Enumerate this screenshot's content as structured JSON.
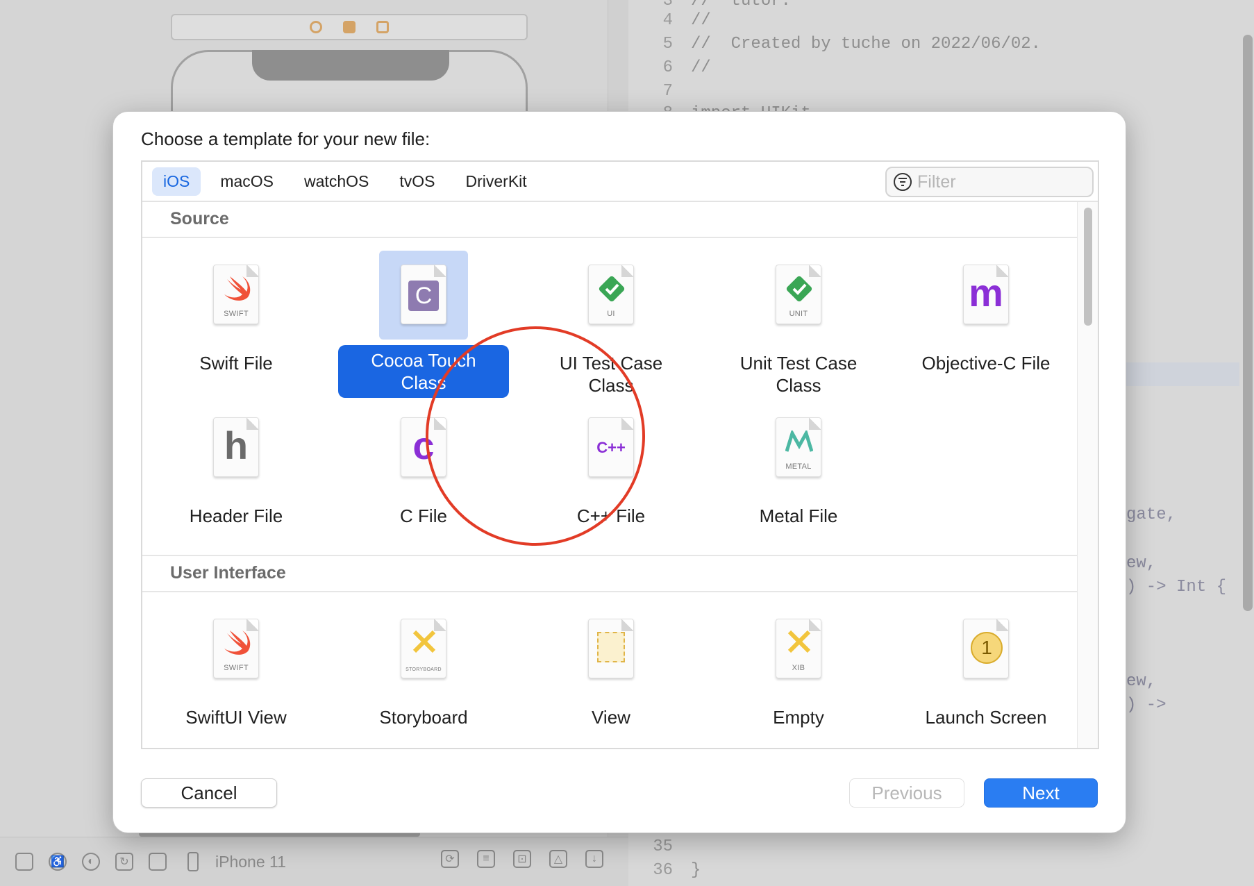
{
  "background": {
    "device_name": "iPhone 11",
    "code_lines": [
      {
        "num": "3",
        "text": "//  tutor."
      },
      {
        "num": "4",
        "text": "//"
      },
      {
        "num": "5",
        "text": "//  Created by tuche on 2022/06/02."
      },
      {
        "num": "6",
        "text": "//"
      },
      {
        "num": "7",
        "text": ""
      },
      {
        "num": "8",
        "text": "import UIKit"
      }
    ],
    "code_fragments": [
      "gate,",
      "ew,",
      ") -> Int {",
      "ew,",
      ") ->"
    ],
    "bottom_lines": [
      {
        "num": "35",
        "text": ""
      },
      {
        "num": "36",
        "text": "}"
      }
    ]
  },
  "dialog": {
    "title": "Choose a template for your new file:",
    "platform_tabs": [
      "iOS",
      "macOS",
      "watchOS",
      "tvOS",
      "DriverKit"
    ],
    "active_tab": "iOS",
    "filter_placeholder": "Filter",
    "sections": [
      {
        "name": "Source",
        "items": [
          {
            "label": "Swift File",
            "icon": "swift-icon",
            "badge": "SWIFT"
          },
          {
            "label": "Cocoa Touch Class",
            "icon": "cocoa-touch-class-icon",
            "badge": "C",
            "selected": true
          },
          {
            "label": "UI Test Case Class",
            "icon": "ui-test-icon",
            "badge": "UI"
          },
          {
            "label": "Unit Test Case Class",
            "icon": "unit-test-icon",
            "badge": "UNIT"
          },
          {
            "label": "Objective-C File",
            "icon": "objective-c-icon",
            "badge": "m"
          },
          {
            "label": "Header File",
            "icon": "header-file-icon",
            "badge": "h"
          },
          {
            "label": "C File",
            "icon": "c-file-icon",
            "badge": "c"
          },
          {
            "label": "C++ File",
            "icon": "cpp-file-icon",
            "badge": "C++"
          },
          {
            "label": "Metal File",
            "icon": "metal-icon",
            "badge": "METAL"
          }
        ]
      },
      {
        "name": "User Interface",
        "items": [
          {
            "label": "SwiftUI View",
            "icon": "swift-icon",
            "badge": "SWIFT"
          },
          {
            "label": "Storyboard",
            "icon": "storyboard-icon",
            "badge": "STORYBOARD"
          },
          {
            "label": "View",
            "icon": "view-icon",
            "badge": ""
          },
          {
            "label": "Empty",
            "icon": "xib-icon",
            "badge": "XIB"
          },
          {
            "label": "Launch Screen",
            "icon": "launch-screen-icon",
            "badge": "1"
          }
        ]
      }
    ],
    "buttons": {
      "cancel": "Cancel",
      "previous": "Previous",
      "next": "Next"
    },
    "colors": {
      "accent": "#2a7df2",
      "selection_label": "#1a66e2",
      "annotation_circle": "#e23b26"
    }
  }
}
